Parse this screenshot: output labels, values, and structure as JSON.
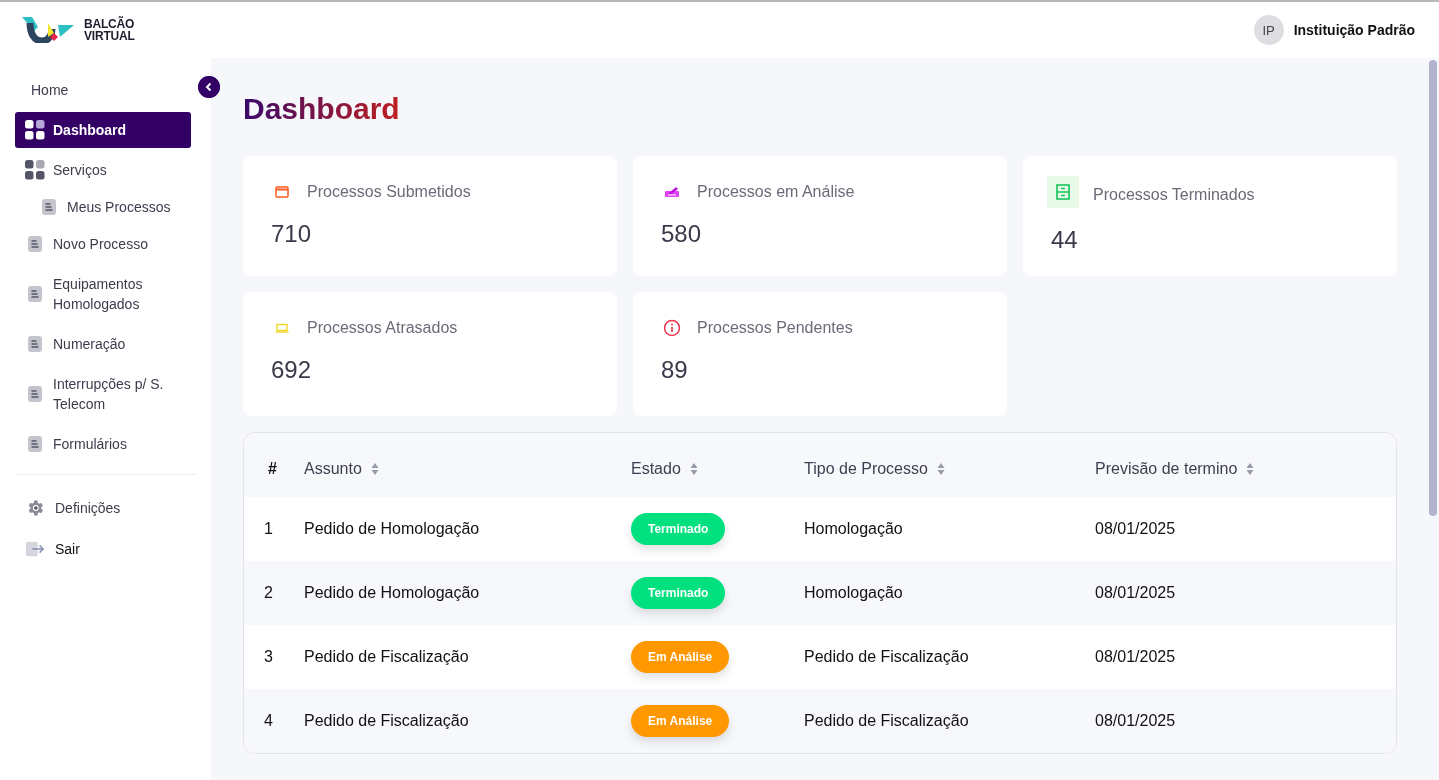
{
  "header": {
    "logo_lines": [
      "BALCÃO",
      "VIRTUAL"
    ],
    "user": {
      "initials": "IP",
      "name": "Instituição Padrão"
    }
  },
  "sidebar": {
    "items": [
      {
        "label": "Home",
        "kind": "plain",
        "selected": false
      },
      {
        "label": "Dashboard",
        "kind": "grid",
        "selected": true
      },
      {
        "label": "Serviços",
        "kind": "grid",
        "selected": false,
        "children": [
          {
            "label": "Meus Processos",
            "kind": "doc",
            "selected": false
          }
        ]
      },
      {
        "label": "Novo Processo",
        "kind": "doc",
        "selected": false
      },
      {
        "label": "Equipamentos Homologados",
        "kind": "doc",
        "selected": false
      },
      {
        "label": "Numeração",
        "kind": "doc",
        "selected": false
      },
      {
        "label": "Interrupções p/ S. Telecom",
        "kind": "doc",
        "selected": false
      },
      {
        "label": "Formulários",
        "kind": "doc",
        "selected": false
      }
    ],
    "bottom_items": [
      {
        "label": "Definições",
        "kind": "gear",
        "selected": false
      },
      {
        "label": "Sair",
        "kind": "exit",
        "selected": false
      }
    ]
  },
  "page_title": "Dashboard",
  "cards": [
    {
      "label": "Processos Submetidos",
      "value": "710",
      "kind": "calendar"
    },
    {
      "label": "Processos em Análise",
      "value": "580",
      "kind": "pen"
    },
    {
      "label": "Processos Terminados",
      "value": "44",
      "kind": "archive"
    },
    {
      "label": "Processos Atrasados",
      "value": "692",
      "kind": "tray"
    },
    {
      "label": "Processos Pendentes",
      "value": "89",
      "kind": "info"
    }
  ],
  "table": {
    "columns": [
      {
        "label": "#",
        "sortable": false
      },
      {
        "label": "Assunto",
        "sortable": true
      },
      {
        "label": "Estado",
        "sortable": true
      },
      {
        "label": "Tipo de Processo",
        "sortable": true
      },
      {
        "label": "Previsão de termino",
        "sortable": true
      }
    ],
    "rows": [
      {
        "number": "1",
        "subject": "Pedido de Homologação",
        "status": {
          "label": "Terminado",
          "kind": "done"
        },
        "type": "Homologação",
        "due": "08/01/2025"
      },
      {
        "number": "2",
        "subject": "Pedido de Homologação",
        "status": {
          "label": "Terminado",
          "kind": "done"
        },
        "type": "Homologação",
        "due": "08/01/2025"
      },
      {
        "number": "3",
        "subject": "Pedido de Fiscalização",
        "status": {
          "label": "Em Análise",
          "kind": "analysis"
        },
        "type": "Pedido de Fiscalização",
        "due": "08/01/2025"
      },
      {
        "number": "4",
        "subject": "Pedido de Fiscalização",
        "status": {
          "label": "Em Análise",
          "kind": "analysis"
        },
        "type": "Pedido de Fiscalização",
        "due": "08/01/2025"
      }
    ]
  }
}
